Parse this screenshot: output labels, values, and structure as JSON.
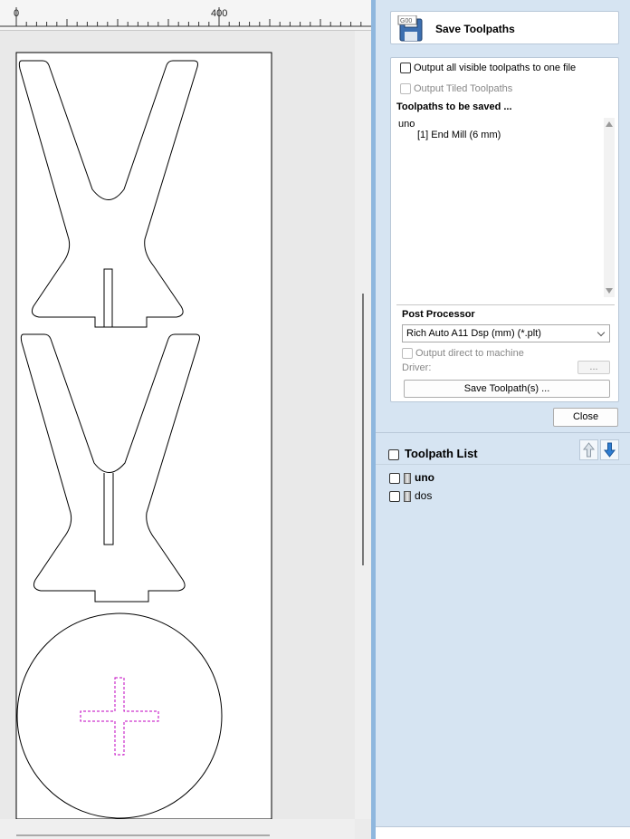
{
  "ruler": {
    "label_0": "0",
    "label_400": "400"
  },
  "panel": {
    "title": "Save Toolpaths",
    "title_icon": "save-toolpath-icon",
    "output_all_label": "Output all visible toolpaths to one file",
    "output_tiled_label": "Output Tiled Toolpaths",
    "to_be_saved_heading": "Toolpaths to be saved ...",
    "saved_list": [
      {
        "text": "uno"
      },
      {
        "text": "[1] End Mill (6 mm)"
      }
    ],
    "post_processor_heading": "Post Processor",
    "post_processor_value": "Rich Auto A11 Dsp (mm) (*.plt)",
    "output_direct_label": "Output direct to machine",
    "driver_label": "Driver:",
    "driver_button": "...",
    "save_button": "Save Toolpath(s) ...",
    "close_button": "Close"
  },
  "toolpath_list": {
    "header": "Toolpath List",
    "items": [
      {
        "name": "uno",
        "bold": true
      },
      {
        "name": "dos",
        "bold": false
      }
    ]
  },
  "colors": {
    "panel_bg": "#d6e4f2",
    "accent": "#2e7dd1",
    "dashed_path": "#c000c0"
  }
}
